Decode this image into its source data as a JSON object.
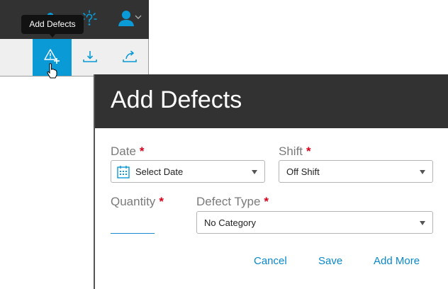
{
  "colors": {
    "toolbar_bg": "#323232",
    "accent": "#0a9ad6",
    "required": "#d9001b",
    "link": "#0a88c8"
  },
  "toolbar": {
    "tooltip": "Add Defects",
    "icons": [
      "help-icon",
      "user-icon",
      "chevron-down-icon"
    ],
    "actions": [
      {
        "name": "add-defects-button",
        "icon": "warning-plus-icon",
        "active": true
      },
      {
        "name": "download-button",
        "icon": "download-icon"
      },
      {
        "name": "share-button",
        "icon": "share-icon"
      }
    ]
  },
  "dialog": {
    "title": "Add Defects",
    "date": {
      "label": "Date",
      "required_mark": "*",
      "value": "Select Date",
      "icon": "calendar-icon"
    },
    "shift": {
      "label": "Shift",
      "required_mark": "*",
      "value": "Off Shift"
    },
    "quantity": {
      "label": "Quantity",
      "required_mark": "*",
      "value": ""
    },
    "defect_type": {
      "label": "Defect Type",
      "required_mark": "*",
      "value": "No Category"
    },
    "buttons": {
      "cancel": "Cancel",
      "save": "Save",
      "add_more": "Add More"
    }
  }
}
